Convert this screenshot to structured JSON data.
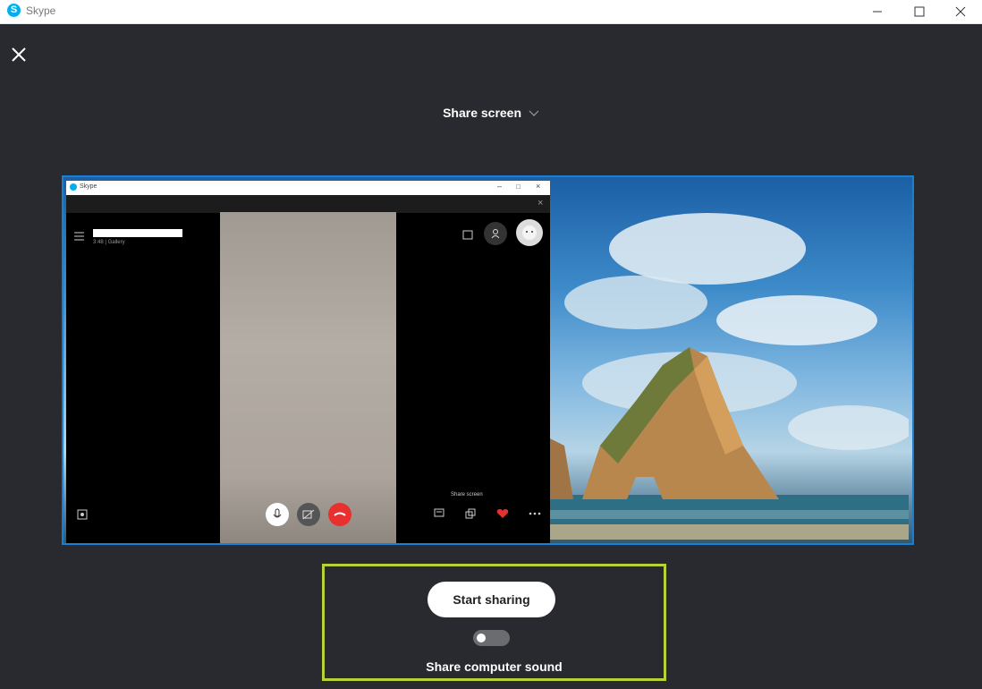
{
  "window": {
    "app_title": "Skype",
    "logo_letter": "S"
  },
  "header": {
    "mode_label": "Share screen"
  },
  "preview": {
    "inner_app_title": "Skype",
    "inner_subtitle": "3:48 | Gallery",
    "inner_share_label": "Share screen"
  },
  "share": {
    "start_label": "Start sharing",
    "sound_label": "Share computer sound",
    "sound_enabled": false
  },
  "colors": {
    "background": "#292a2f",
    "preview_border": "#1a7fd1",
    "highlight_border": "#b5d334",
    "end_call": "#e8312f"
  },
  "icons": [
    "skype-logo-icon",
    "minimize-icon",
    "maximize-icon",
    "window-close-icon",
    "close-icon",
    "chevron-down-icon",
    "microphone-icon",
    "video-off-icon",
    "end-call-icon",
    "chat-icon",
    "layout-icon",
    "heart-icon",
    "more-icon"
  ]
}
